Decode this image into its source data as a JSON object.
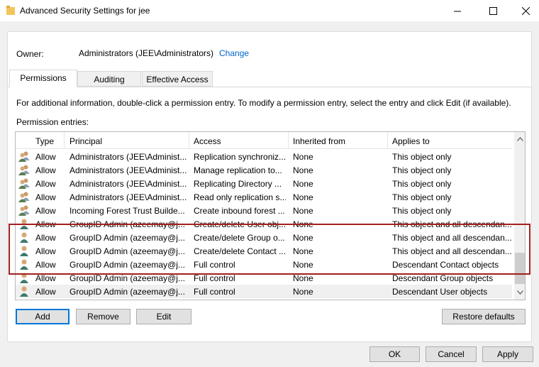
{
  "window": {
    "title": "Advanced Security Settings for jee",
    "buttons": [
      "minimize-icon",
      "maximize-icon",
      "close-icon"
    ]
  },
  "owner": {
    "label": "Owner:",
    "value": "Administrators (JEE\\Administrators)",
    "change_label": "Change"
  },
  "tabs": [
    {
      "label": "Permissions",
      "active": true
    },
    {
      "label": "Auditing",
      "active": false
    },
    {
      "label": "Effective Access",
      "active": false
    }
  ],
  "info_text": "For additional information, double-click a permission entry. To modify a permission entry, select the entry and click Edit (if available).",
  "entries_label": "Permission entries:",
  "columns": [
    "Type",
    "Principal",
    "Access",
    "Inherited from",
    "Applies to"
  ],
  "rows": [
    {
      "icon": "group-icon",
      "type": "Allow",
      "principal": "Administrators (JEE\\Administ...",
      "access": "Replication synchroniz...",
      "inherited": "None",
      "applies": "This object only"
    },
    {
      "icon": "group-icon",
      "type": "Allow",
      "principal": "Administrators (JEE\\Administ...",
      "access": "Manage replication to...",
      "inherited": "None",
      "applies": "This object only"
    },
    {
      "icon": "group-icon",
      "type": "Allow",
      "principal": "Administrators (JEE\\Administ...",
      "access": "Replicating Directory ...",
      "inherited": "None",
      "applies": "This object only"
    },
    {
      "icon": "group-icon",
      "type": "Allow",
      "principal": "Administrators (JEE\\Administ...",
      "access": "Read only replication s...",
      "inherited": "None",
      "applies": "This object only"
    },
    {
      "icon": "group-icon",
      "type": "Allow",
      "principal": "Incoming Forest Trust Builde...",
      "access": "Create inbound forest ...",
      "inherited": "None",
      "applies": "This object only"
    },
    {
      "icon": "user-icon",
      "type": "Allow",
      "principal": "GroupID Admin (azeemay@j...",
      "access": "Create/delete User obj...",
      "inherited": "None",
      "applies": "This object and all descendan..."
    },
    {
      "icon": "user-icon",
      "type": "Allow",
      "principal": "GroupID Admin (azeemay@j...",
      "access": "Create/delete Group o...",
      "inherited": "None",
      "applies": "This object and all descendan..."
    },
    {
      "icon": "user-icon",
      "type": "Allow",
      "principal": "GroupID Admin (azeemay@j...",
      "access": "Create/delete Contact ...",
      "inherited": "None",
      "applies": "This object and all descendan..."
    },
    {
      "icon": "user-icon",
      "type": "Allow",
      "principal": "GroupID Admin (azeemay@j...",
      "access": "Full control",
      "inherited": "None",
      "applies": "Descendant Contact objects"
    },
    {
      "icon": "user-icon",
      "type": "Allow",
      "principal": "GroupID Admin (azeemay@j...",
      "access": "Full control",
      "inherited": "None",
      "applies": "Descendant Group objects"
    },
    {
      "icon": "user-icon",
      "type": "Allow",
      "principal": "GroupID Admin (azeemay@j...",
      "access": "Full control",
      "inherited": "None",
      "applies": "Descendant User objects",
      "selected": true
    }
  ],
  "actions": {
    "add": "Add",
    "remove": "Remove",
    "edit": "Edit",
    "restore": "Restore defaults"
  },
  "footer": {
    "ok": "OK",
    "cancel": "Cancel",
    "apply": "Apply"
  },
  "colors": {
    "link": "#0066cc",
    "highlight_box": "#a31f1f",
    "primary_border": "#0078d7"
  }
}
